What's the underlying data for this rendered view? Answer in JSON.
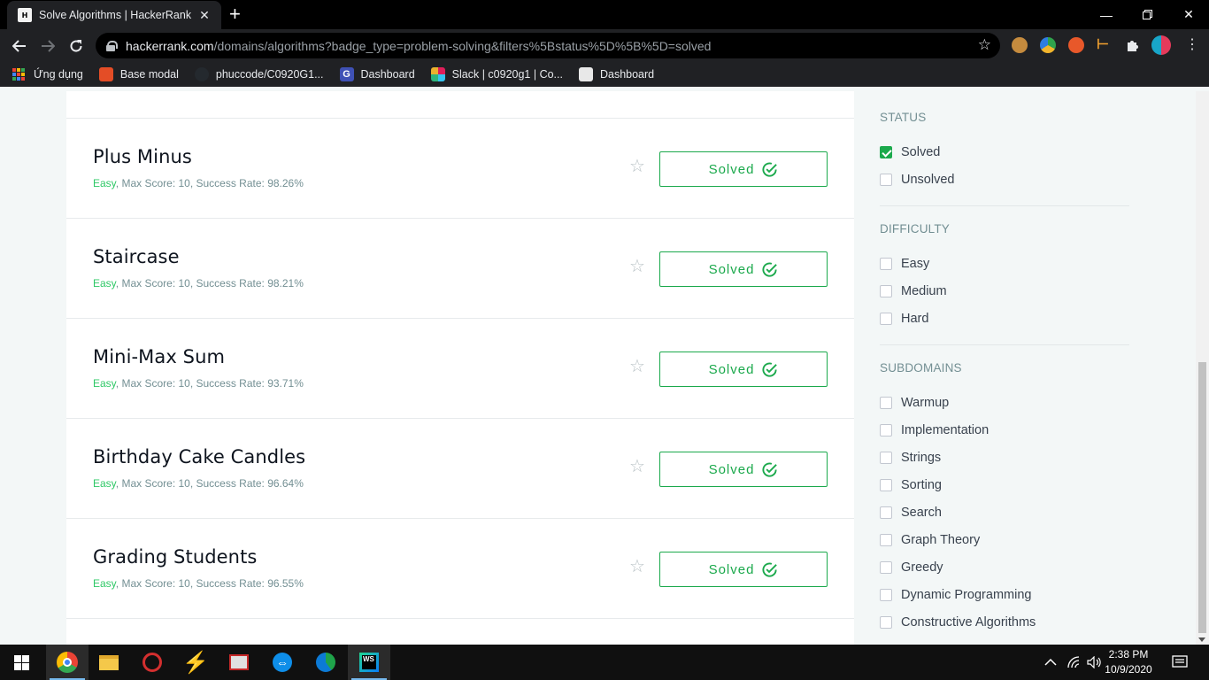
{
  "browser": {
    "tab_title": "Solve Algorithms | HackerRank",
    "tab_favicon_text": "H",
    "new_tab_symbol": "+",
    "url_host": "hackerrank.com",
    "url_path": "/domains/algorithms?badge_type=problem-solving&filters%5Bstatus%5D%5B%5D=solved",
    "bookmarks": [
      {
        "label": "Ứng dụng"
      },
      {
        "label": "Base modal"
      },
      {
        "label": "phuccode/C0920G1..."
      },
      {
        "label": "Dashboard"
      },
      {
        "label": "Slack | c0920g1 | Co..."
      },
      {
        "label": "Dashboard"
      }
    ]
  },
  "challenges": [
    {
      "title": "Plus Minus",
      "difficulty": "Easy",
      "meta": ", Max Score: 10, Success Rate: 98.26%",
      "status": "Solved"
    },
    {
      "title": "Staircase",
      "difficulty": "Easy",
      "meta": ", Max Score: 10, Success Rate: 98.21%",
      "status": "Solved"
    },
    {
      "title": "Mini-Max Sum",
      "difficulty": "Easy",
      "meta": ", Max Score: 10, Success Rate: 93.71%",
      "status": "Solved"
    },
    {
      "title": "Birthday Cake Candles",
      "difficulty": "Easy",
      "meta": ", Max Score: 10, Success Rate: 96.64%",
      "status": "Solved"
    },
    {
      "title": "Grading Students",
      "difficulty": "Easy",
      "meta": ", Max Score: 10, Success Rate: 96.55%",
      "status": "Solved"
    }
  ],
  "filters": {
    "status": {
      "heading": "STATUS",
      "options": [
        {
          "label": "Solved",
          "checked": true
        },
        {
          "label": "Unsolved",
          "checked": false
        }
      ]
    },
    "difficulty": {
      "heading": "DIFFICULTY",
      "options": [
        {
          "label": "Easy",
          "checked": false
        },
        {
          "label": "Medium",
          "checked": false
        },
        {
          "label": "Hard",
          "checked": false
        }
      ]
    },
    "subdomains": {
      "heading": "SUBDOMAINS",
      "options": [
        {
          "label": "Warmup",
          "checked": false
        },
        {
          "label": "Implementation",
          "checked": false
        },
        {
          "label": "Strings",
          "checked": false
        },
        {
          "label": "Sorting",
          "checked": false
        },
        {
          "label": "Search",
          "checked": false
        },
        {
          "label": "Graph Theory",
          "checked": false
        },
        {
          "label": "Greedy",
          "checked": false
        },
        {
          "label": "Dynamic Programming",
          "checked": false
        },
        {
          "label": "Constructive Algorithms",
          "checked": false
        }
      ]
    }
  },
  "taskbar": {
    "time": "2:38 PM",
    "date": "10/9/2020"
  },
  "colors": {
    "accent_green": "#1ba94c",
    "difficulty_easy": "#2ec866",
    "meta_gray": "#738f93",
    "chrome_dark": "#202124"
  }
}
